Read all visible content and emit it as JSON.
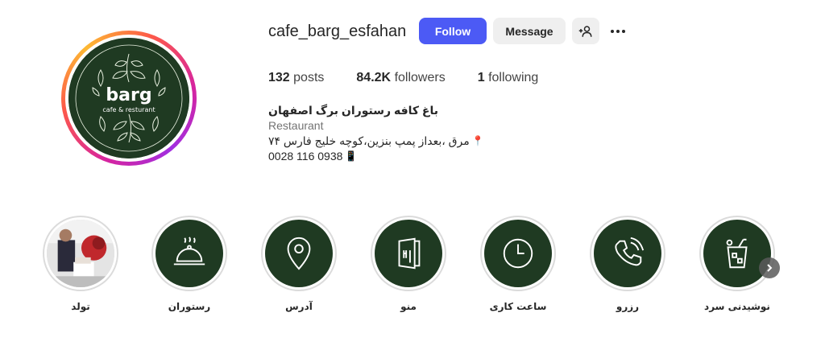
{
  "profile": {
    "username": "cafe_barg_esfahan",
    "avatar_logo": "barg",
    "avatar_tagline": "cafe & resturant"
  },
  "actions": {
    "follow": "Follow",
    "message": "Message",
    "add_user_icon": "person-add-icon",
    "more_icon": "more-horizontal-icon"
  },
  "stats": [
    {
      "count": "132",
      "label": "posts"
    },
    {
      "count": "84.2K",
      "label": "followers"
    },
    {
      "count": "1",
      "label": "following"
    }
  ],
  "bio": {
    "name": "باغ کافه رستوران برگ اصفهان",
    "category": "Restaurant",
    "address": "مرق ،بعداز پمپ بنزین،کوچه خلیج فارس ۷۴",
    "address_icon": "📍",
    "phone": "0028 116 0938",
    "phone_icon": "📱"
  },
  "highlights": [
    {
      "label": "نوشیدنی سرد",
      "icon": "cold-drink-icon"
    },
    {
      "label": "رزرو",
      "icon": "phone-icon"
    },
    {
      "label": "ساعت کاری",
      "icon": "clock-icon"
    },
    {
      "label": "منو",
      "icon": "menu-icon"
    },
    {
      "label": "آدرس",
      "icon": "location-pin-icon"
    },
    {
      "label": "رستوران",
      "icon": "cloche-icon"
    },
    {
      "label": "تولد",
      "icon": "birthday-photo"
    }
  ],
  "colors": {
    "follow_blue": "#4c5af5",
    "brand_green": "#1f3a22",
    "button_gray": "#efefef"
  }
}
